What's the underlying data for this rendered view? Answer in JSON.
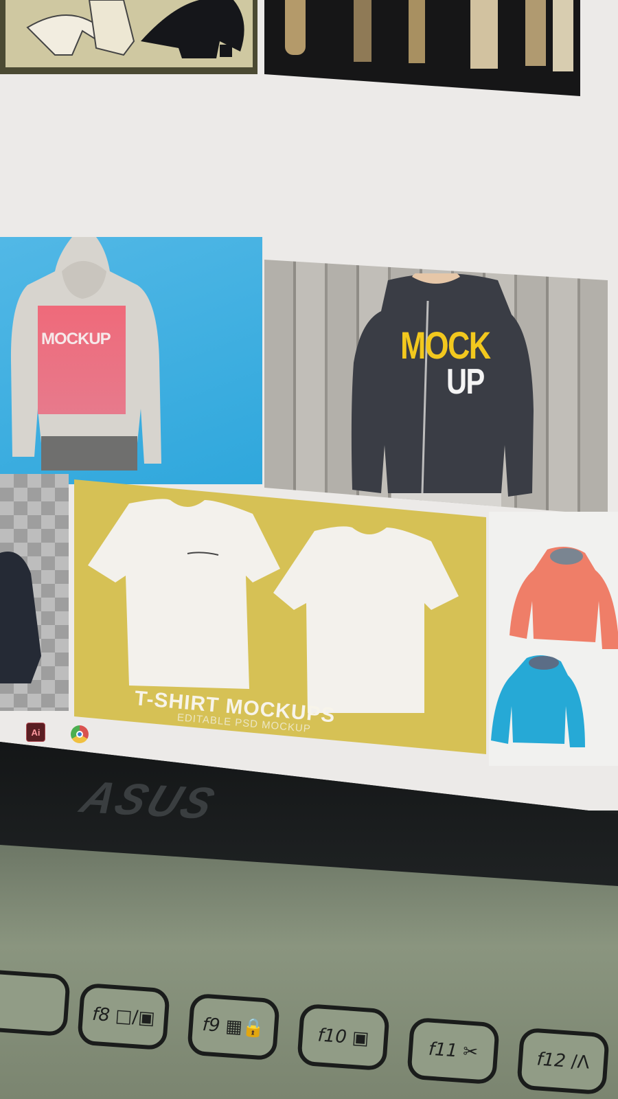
{
  "gallery": {
    "tile_hoodie_back": {
      "print_text": "MOCKUP"
    },
    "tile_zip_hoodie": {
      "print_line1": "MOCK",
      "print_line2": "UP"
    },
    "tile_tshirt": {
      "title": "T-SHIRT MOCKUPS",
      "subtitle": "EDITABLE PSD MOCKUP"
    }
  },
  "taskbar": {
    "app1_label": "Ai",
    "app1_icon": "adobe-acrobat-icon",
    "app2_icon": "chrome-icon"
  },
  "laptop": {
    "brand": "ASUS"
  },
  "keyboard": {
    "keys": [
      {
        "label": "f8",
        "icon": "display-switch-icon"
      },
      {
        "label": "f9",
        "icon": "lock-icon"
      },
      {
        "label": "f10",
        "icon": "camera-off-icon"
      },
      {
        "label": "f11",
        "icon": "snipping-icon"
      },
      {
        "label": "f12",
        "icon": "fn-icon"
      }
    ]
  },
  "colors": {
    "screen_bg": "#eceae8",
    "sky_blue": "#3daee0",
    "mock_pink": "#e55c6e",
    "mock_yellow": "#f2c81e",
    "tshirt_bg": "#d9c455",
    "jacket_coral": "#ef7e68",
    "jacket_cyan": "#26a9d6"
  }
}
